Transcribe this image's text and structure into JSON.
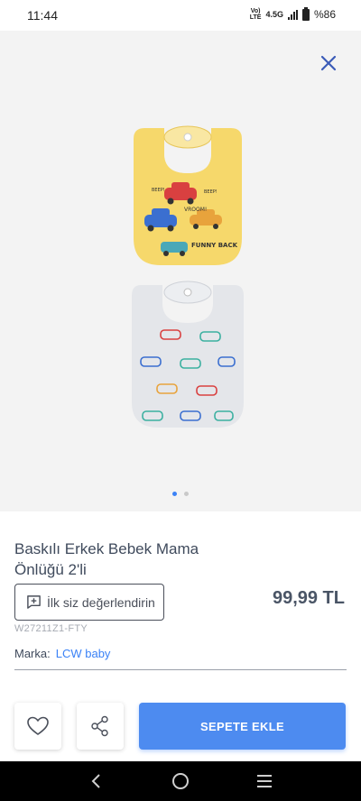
{
  "status_bar": {
    "time": "11:44",
    "volte": "Vo) LTE",
    "network": "4.5G",
    "battery": "%86"
  },
  "gallery": {
    "image_count": 2,
    "active_index": 0,
    "bib_top_text": [
      "VROOM!",
      "FUNNY BACK",
      "BEEP!",
      "BEEP!"
    ]
  },
  "product": {
    "title": "Baskılı Erkek Bebek Mama Önlüğü 2'li",
    "review_label": "İlk siz değerlendirin",
    "price": "99,99 TL",
    "sku": "W27211Z1-FTY",
    "brand_label": "Marka:",
    "brand_name": "LCW baby"
  },
  "actions": {
    "cart_label": "SEPETE EKLE"
  },
  "colors": {
    "accent": "#4d8bf0",
    "close_icon": "#3b5bb8",
    "bib_yellow": "#f6d86b",
    "bib_gray": "#e4e6ea"
  }
}
